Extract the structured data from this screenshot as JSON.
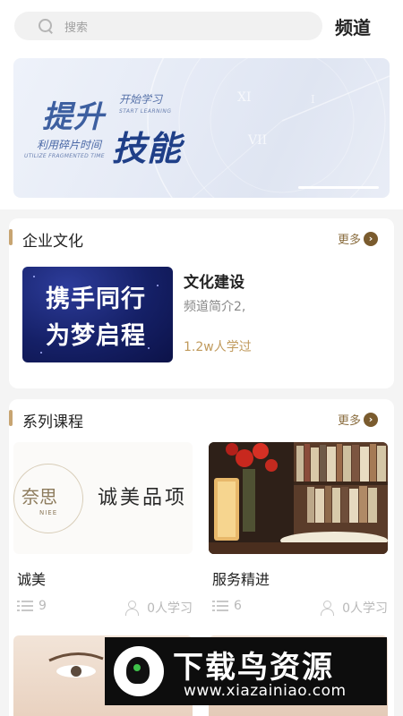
{
  "search": {
    "placeholder": "搜索"
  },
  "header": {
    "channel_label": "频道"
  },
  "banner": {
    "title_main": "提升",
    "title_skill": "技能",
    "sub_cn": "开始学习",
    "sub_en": "START LEARNING",
    "tagline_cn": "利用碎片时间",
    "tagline_en": "UTILIZE FRAGMENTED TIME"
  },
  "culture": {
    "title": "企业文化",
    "more_label": "更多",
    "item": {
      "image_line1": "携手同行",
      "image_line2": "为梦启程",
      "title": "文化建设",
      "description": "频道简介2,",
      "learners": "1.2w人学过"
    }
  },
  "courses": {
    "title": "系列课程",
    "more_label": "更多",
    "items": [
      {
        "name": "诚美",
        "image_logo_cn": "奈思",
        "image_logo_en": "NIEE",
        "image_text": "诚美品项",
        "count": "9",
        "learners": "0人学习"
      },
      {
        "name": "服务精进",
        "count": "6",
        "learners": "0人学习"
      }
    ]
  },
  "watermark": {
    "title": "下载鸟资源",
    "url": "www.xiazainiao.com"
  },
  "colors": {
    "accent": "#c7a471",
    "more": "#8a6d3f",
    "learners_gold": "#c09a5c"
  }
}
